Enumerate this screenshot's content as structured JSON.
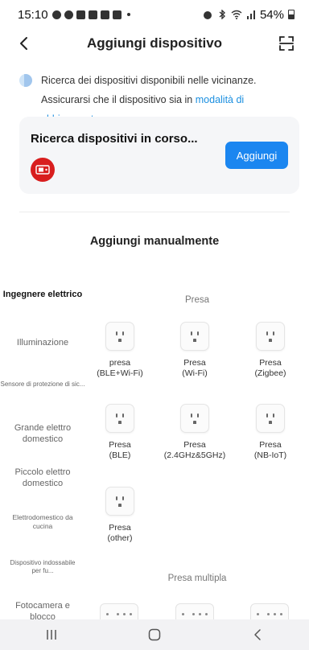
{
  "status_bar": {
    "time": "15:10",
    "battery": "54%"
  },
  "header": {
    "title": "Aggiungi dispositivo"
  },
  "notice": {
    "text_before": "Ricerca dei dispositivi disponibili nelle vicinanze. Assicurarsi che il dispositivo sia in ",
    "link": "modalità di abbinamento",
    "text_after": "."
  },
  "search_card": {
    "title": "Ricerca dispositivi in corso...",
    "add_label": "Aggiungi"
  },
  "manual": {
    "title": "Aggiungi manualmente"
  },
  "categories": [
    {
      "label": "Ingegnere elettrico",
      "active": true
    },
    {
      "label": "Illuminazione"
    },
    {
      "label": "Sensore di protezione di sic..."
    },
    {
      "label": "Grande elettro domestico"
    },
    {
      "label": "Piccolo elettro domestico"
    },
    {
      "label": "Elettrodomestico da cucina"
    },
    {
      "label": "Dispositivo indossabile per fu..."
    },
    {
      "label": "Fotocamera e blocco"
    }
  ],
  "sections": [
    {
      "title": "Presa",
      "devices": [
        {
          "line1": "presa",
          "line2": "(BLE+Wi-Fi)"
        },
        {
          "line1": "Presa",
          "line2": "(Wi-Fi)"
        },
        {
          "line1": "Presa",
          "line2": "(Zigbee)"
        },
        {
          "line1": "Presa",
          "line2": "(BLE)"
        },
        {
          "line1": "Presa",
          "line2": "(2.4GHz&5GHz)"
        },
        {
          "line1": "Presa",
          "line2": "(NB-IoT)"
        },
        {
          "line1": "Presa",
          "line2": "(other)"
        }
      ]
    },
    {
      "title": "Presa multipla"
    }
  ],
  "icons": {
    "back": "chevron-left-icon",
    "scan": "scan-icon",
    "bluetooth_search": "bluetooth-search-icon",
    "found_device": "device-icon",
    "socket": "socket-icon",
    "power_strip": "power-strip-icon"
  },
  "colors": {
    "accent": "#1b86f0",
    "link": "#1b8fe0",
    "device_badge": "#d81e1e"
  }
}
